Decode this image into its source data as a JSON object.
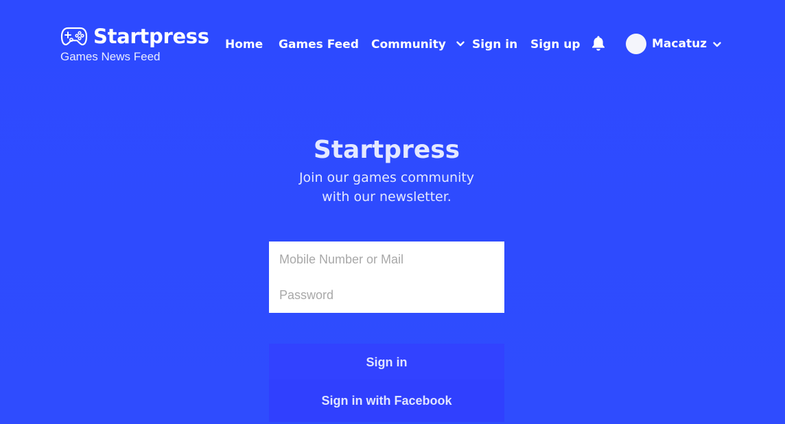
{
  "brand": {
    "title": "Startpress",
    "subtitle": "Games News Feed",
    "icon": "gamepad-icon"
  },
  "nav": {
    "items": [
      {
        "label": "Home"
      },
      {
        "label": "Games Feed"
      },
      {
        "label": "Community",
        "has_dropdown": true
      },
      {
        "label": "Sign in"
      },
      {
        "label": "Sign up"
      }
    ],
    "notification_icon": "bell-icon"
  },
  "user": {
    "name": "Macatuz",
    "has_dropdown": true
  },
  "hero": {
    "title": "Startpress",
    "subtitle_line1": "Join our games community",
    "subtitle_line2": "with our newsletter."
  },
  "form": {
    "username_placeholder": "Mobile Number or Mail",
    "password_placeholder": "Password",
    "signin_label": "Sign in",
    "facebook_label": "Sign in with Facebook"
  },
  "colors": {
    "background": "#2e4bff",
    "button": "#3242ff",
    "text_light": "#e4e8ff",
    "field_bg": "#ffffff"
  }
}
